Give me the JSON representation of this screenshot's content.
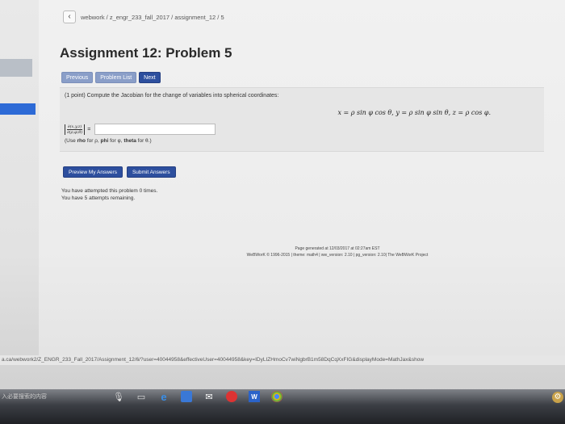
{
  "breadcrumb": "webwork / z_engr_233_fall_2017 / assignment_12 / 5",
  "title": "Assignment 12: Problem 5",
  "nav": {
    "previous": "Previous",
    "problem_list": "Problem List",
    "next": "Next"
  },
  "problem": {
    "statement": "(1 point) Compute the Jacobian for the change of variables into spherical coordinates:",
    "formula": "x = ρ sin φ cos θ,   y = ρ sin φ sin θ,   z = ρ cos φ.",
    "jacobian_num": "∂(x,y,z)",
    "jacobian_den": "∂(ρ,φ,θ)",
    "equals": "=",
    "answer_value": "",
    "hint_prefix": "(Use ",
    "hint_rho": "rho",
    "hint_for_rho": " for ρ, ",
    "hint_phi": "phi",
    "hint_for_phi": " for φ, ",
    "hint_theta": "theta",
    "hint_for_theta": " for θ.)"
  },
  "actions": {
    "preview": "Preview My Answers",
    "submit": "Submit Answers"
  },
  "attempts": {
    "line1": "You have attempted this problem 0 times.",
    "line2": "You have 5 attempts remaining."
  },
  "footer": {
    "line1": "Page generated at 12/03/2017 at 02:27am EST",
    "line2": "WeBWorK © 1996-2015 | theme: math4 | ww_version: 2.10 | pg_version: 2.10| The WeBWorK Project"
  },
  "status_url": "a.ca/webwork2/Z_ENGR_233_Fall_2017/Assignment_12/6/?user=40044958&effectiveUser=40044958&key=IDyLIZHmoCv7wiNgbrB1m58DqCqXxFIG&displayMode=MathJax&show",
  "taskbar": {
    "search_text": "入必要搜索的内容",
    "word_label": "W"
  },
  "colors": {
    "button_blue": "#2d4f9e",
    "button_disabled": "#8a9ec8"
  }
}
